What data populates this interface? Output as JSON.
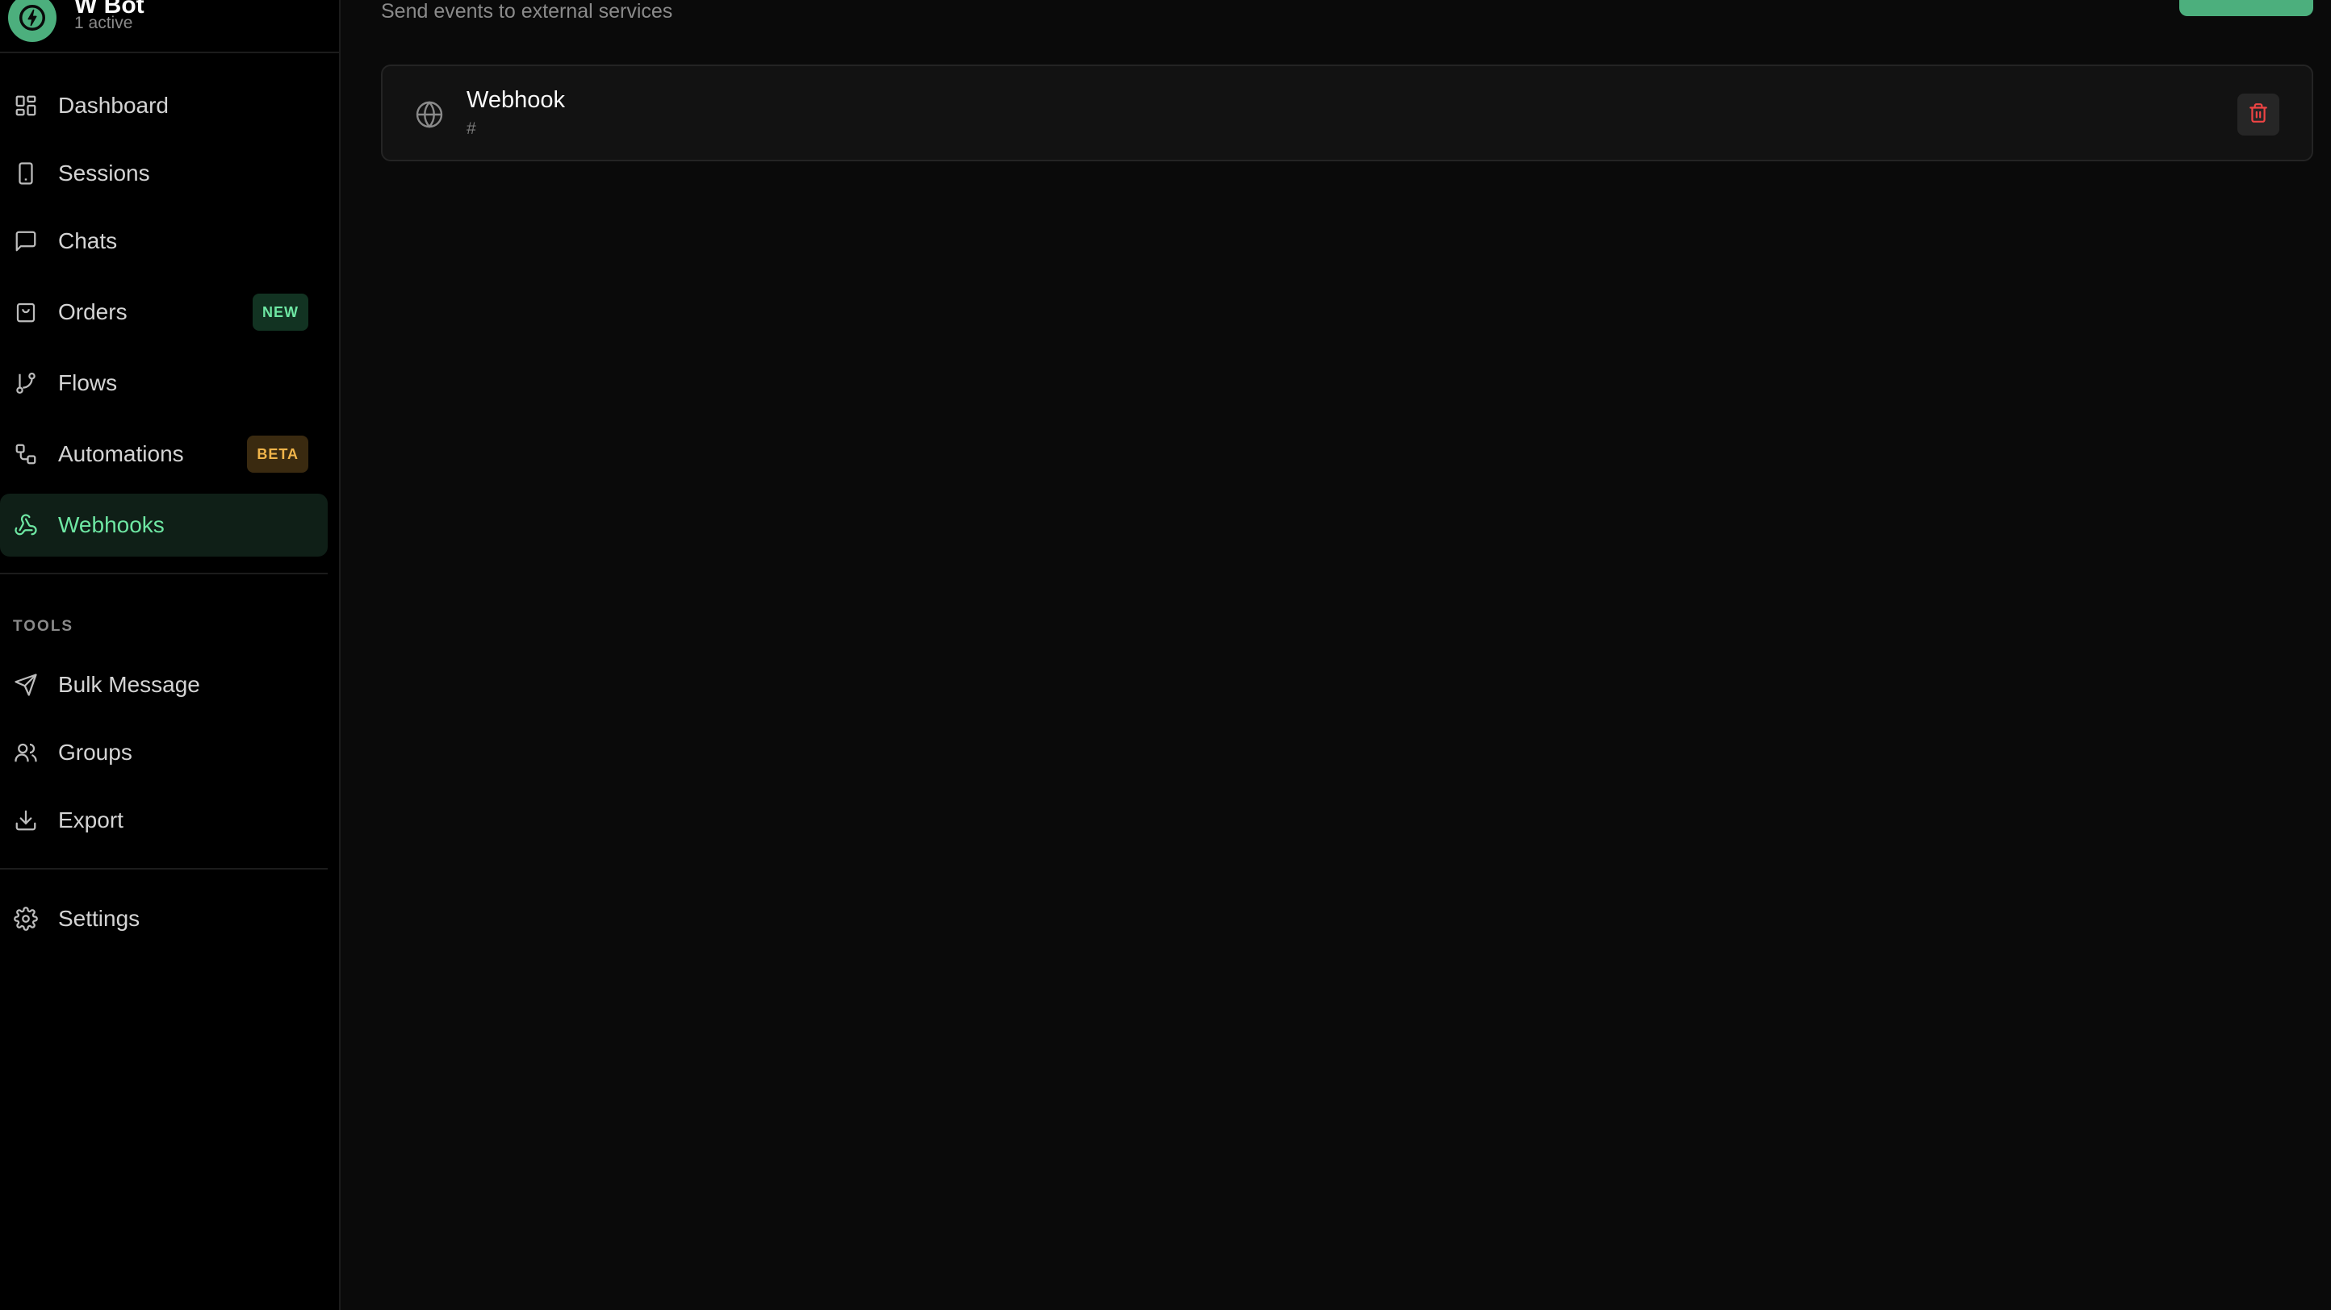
{
  "brand": {
    "name": "W Bot",
    "status": "1 active"
  },
  "sidebar": {
    "items": [
      {
        "label": "Dashboard",
        "icon": "grid-icon"
      },
      {
        "label": "Sessions",
        "icon": "phone-icon"
      },
      {
        "label": "Chats",
        "icon": "message-square-icon"
      },
      {
        "label": "Orders",
        "icon": "shopping-bag-icon",
        "badge": "NEW"
      },
      {
        "label": "Flows",
        "icon": "git-branch-icon"
      },
      {
        "label": "Automations",
        "icon": "workflow-icon",
        "badge": "BETA"
      },
      {
        "label": "Webhooks",
        "icon": "webhook-icon",
        "active": true
      }
    ],
    "tools_title": "TOOLS",
    "tools": [
      {
        "label": "Bulk Message",
        "icon": "send-icon"
      },
      {
        "label": "Groups",
        "icon": "users-icon"
      },
      {
        "label": "Export",
        "icon": "download-icon"
      }
    ],
    "settings": {
      "label": "Settings",
      "icon": "gear-icon"
    }
  },
  "main": {
    "subtitle": "Send events to external services",
    "webhooks": [
      {
        "name": "Webhook",
        "url": "#"
      }
    ]
  },
  "colors": {
    "accent": "#4caf7d",
    "accent_text": "#6ee7a3",
    "beta": "#f0b44a",
    "danger": "#ef4444",
    "background": "#0a0a0a",
    "sidebar_bg": "#000000"
  }
}
